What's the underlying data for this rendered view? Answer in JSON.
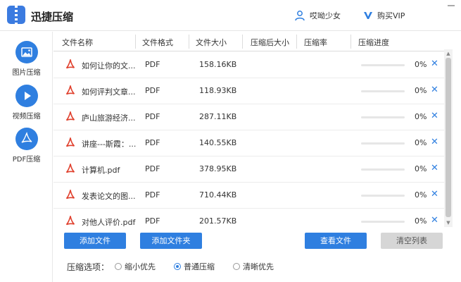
{
  "app": {
    "title": "迅捷压缩"
  },
  "header": {
    "user_name": "哎呦少女",
    "vip_label": "购买VIP"
  },
  "sidebar": {
    "items": [
      {
        "label": "图片压缩",
        "icon": "image-icon"
      },
      {
        "label": "视频压缩",
        "icon": "play-icon"
      },
      {
        "label": "PDF压缩",
        "icon": "pdf-icon",
        "active": true
      }
    ]
  },
  "table": {
    "headers": [
      "文件名称",
      "文件格式",
      "文件大小",
      "压缩后大小",
      "压缩率",
      "压缩进度"
    ],
    "rows": [
      {
        "name": "如何让你的文...",
        "format": "PDF",
        "size": "158.16KB",
        "compressed_size": "",
        "ratio": "",
        "progress": "0%",
        "progress_value": 0
      },
      {
        "name": "如何评判文章...",
        "format": "PDF",
        "size": "118.93KB",
        "compressed_size": "",
        "ratio": "",
        "progress": "0%",
        "progress_value": 0
      },
      {
        "name": "庐山旅游经济...",
        "format": "PDF",
        "size": "287.11KB",
        "compressed_size": "",
        "ratio": "",
        "progress": "0%",
        "progress_value": 0
      },
      {
        "name": "讲座---斯霞：...",
        "format": "PDF",
        "size": "140.55KB",
        "compressed_size": "",
        "ratio": "",
        "progress": "0%",
        "progress_value": 0
      },
      {
        "name": "计算机.pdf",
        "format": "PDF",
        "size": "378.95KB",
        "compressed_size": "",
        "ratio": "",
        "progress": "0%",
        "progress_value": 0
      },
      {
        "name": "发表论文的图...",
        "format": "PDF",
        "size": "710.44KB",
        "compressed_size": "",
        "ratio": "",
        "progress": "0%",
        "progress_value": 0
      },
      {
        "name": "对他人评价.pdf",
        "format": "PDF",
        "size": "201.57KB",
        "compressed_size": "",
        "ratio": "",
        "progress": "0%",
        "progress_value": 0
      }
    ]
  },
  "buttons": {
    "add_file": "添加文件",
    "add_folder": "添加文件夹",
    "view_file": "查看文件",
    "clear_list": "清空列表"
  },
  "options": {
    "title": "压缩选项：",
    "choices": [
      {
        "label": "缩小优先",
        "selected": false
      },
      {
        "label": "普通压缩",
        "selected": true
      },
      {
        "label": "清晰优先",
        "selected": false
      }
    ]
  },
  "colors": {
    "accent": "#2f7fe0",
    "pdf_red": "#e0412e"
  }
}
